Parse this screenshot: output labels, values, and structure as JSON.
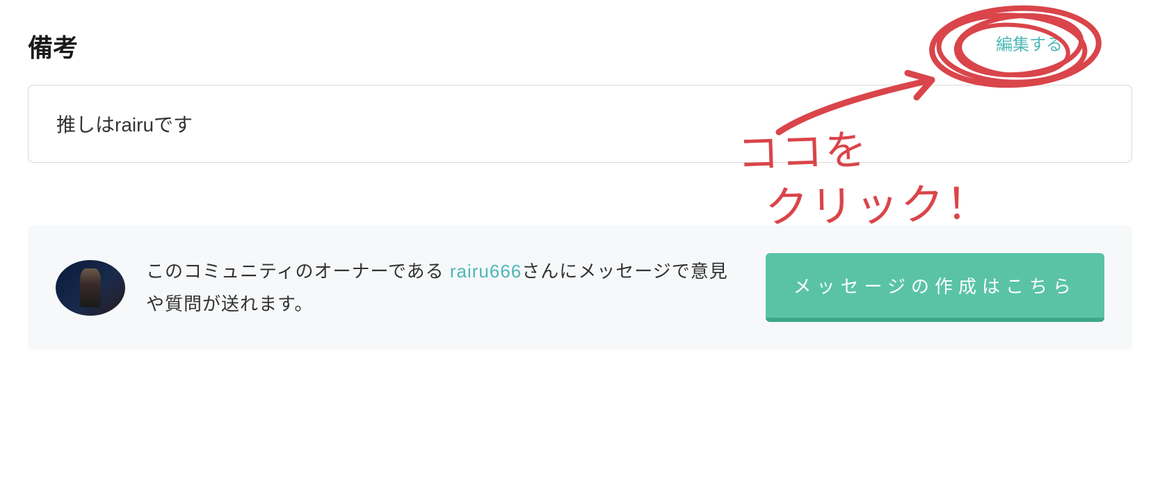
{
  "section": {
    "title": "備考",
    "edit_label": "編集する",
    "content": "推しはrairuです"
  },
  "message_panel": {
    "text_before": "このコミュニティのオーナーである ",
    "owner_name": "rairu666",
    "text_after": "さんにメッセージで意見や質問が送れます。",
    "button_label": "メッセージの作成はこちら"
  },
  "annotation": {
    "line1": "ココを",
    "line2": "クリック！"
  }
}
